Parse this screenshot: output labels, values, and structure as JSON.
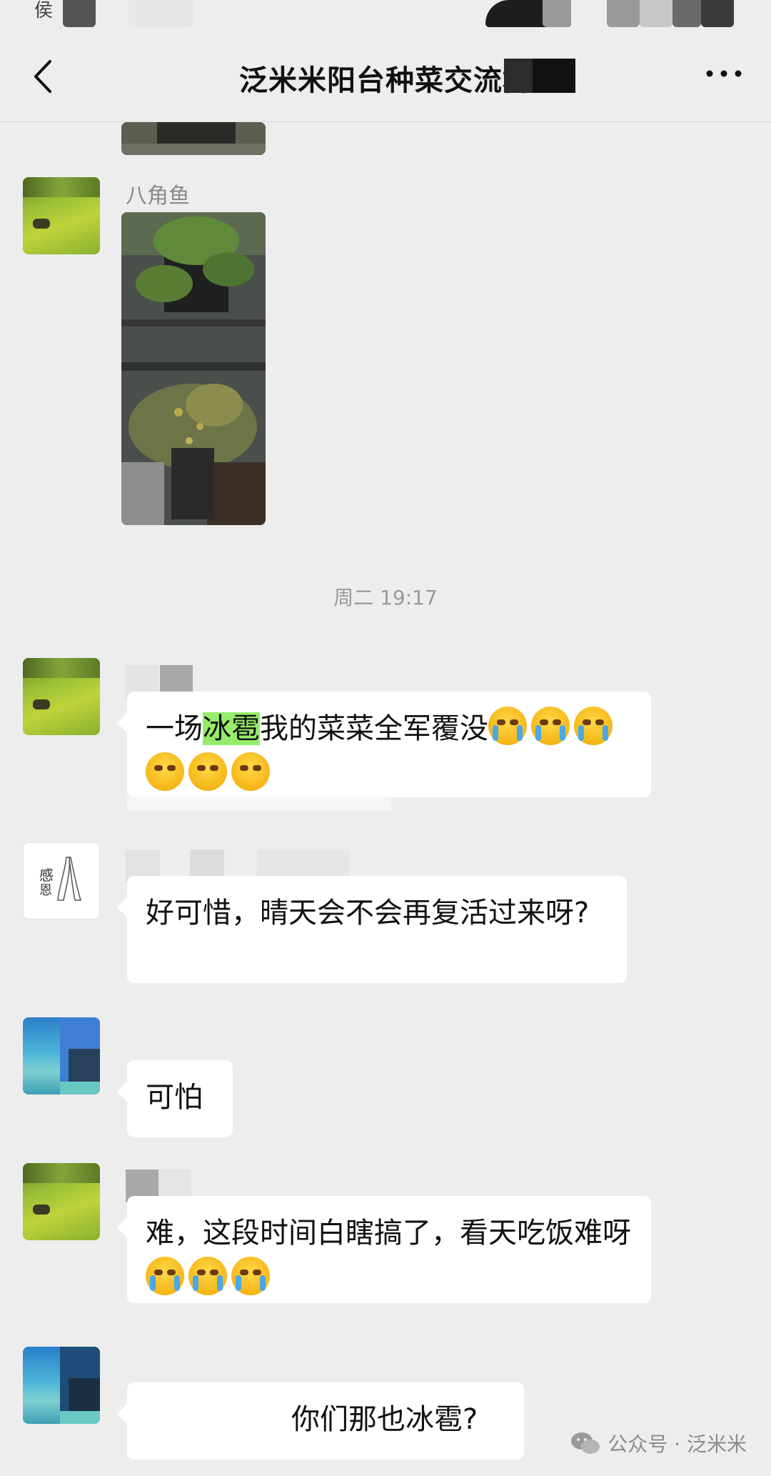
{
  "header": {
    "title": "泛米米阳台种菜交流群"
  },
  "messages": {
    "m1_sender": "八角鱼",
    "time_divider": "周二 19:17",
    "m2_text_before": "一场",
    "m2_highlight": "冰雹",
    "m2_text_after": "我的菜菜全军覆没",
    "m3_text": "好可惜，晴天会不会再复活过来呀?",
    "m4_text": "可怕",
    "m5_text": "难，这段时间白瞎搞了，看天吃饭难呀",
    "m6_text": "你们那也冰雹?"
  },
  "watermark": {
    "text": "公众号 · 泛米米"
  },
  "colors": {
    "background": "#ededed",
    "bubble": "#ffffff",
    "highlight": "#95ec69"
  },
  "icons": [
    "back-chevron-icon",
    "more-dots-icon",
    "wechat-icon"
  ]
}
